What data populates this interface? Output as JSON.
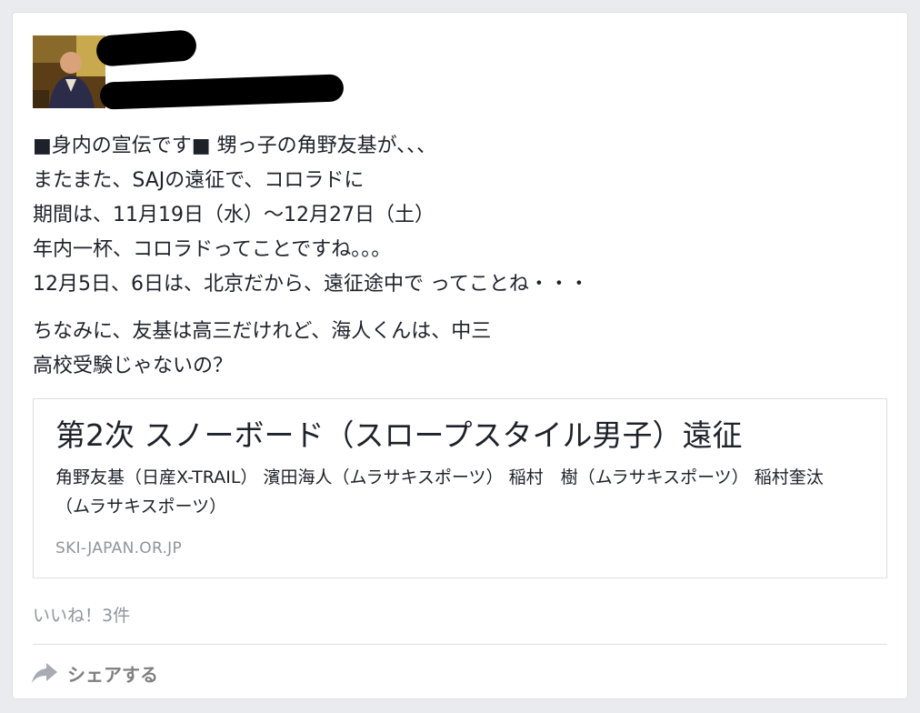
{
  "post": {
    "author": {
      "avatar_icon": "profile-photo",
      "name_redacted": true
    },
    "paragraphs": [
      [
        "■身内の宣伝です■ 甥っ子の角野友基が、、、",
        "またまた、SAJの遠征で、コロラドに",
        "期間は、11月19日（水）〜12月27日（土）",
        "年内一杯、コロラドってことですね。。。",
        "12月5日、6日は、北京だから、遠征途中で ってことね・・・"
      ],
      [
        "ちなみに、友基は高三だけれど、海人くんは、中三",
        "高校受験じゃないの？"
      ]
    ],
    "link": {
      "title": "第2次 スノーボード（スロープスタイル男子）遠征",
      "description": "角野友基（日産X-TRAIL） 濱田海人（ムラサキスポーツ） 稲村　樹（ムラサキスポーツ） 稲村奎汰（ムラサキスポーツ）",
      "domain": "SKI-JAPAN.OR.JP"
    },
    "likes_text": "いいね！3件",
    "share_label": "シェアする",
    "share_icon": "share-arrow-icon",
    "colors": {
      "background": "#e9ebee",
      "text": "#1d2129",
      "muted": "#90949c",
      "share": "#7f7f7f"
    }
  }
}
